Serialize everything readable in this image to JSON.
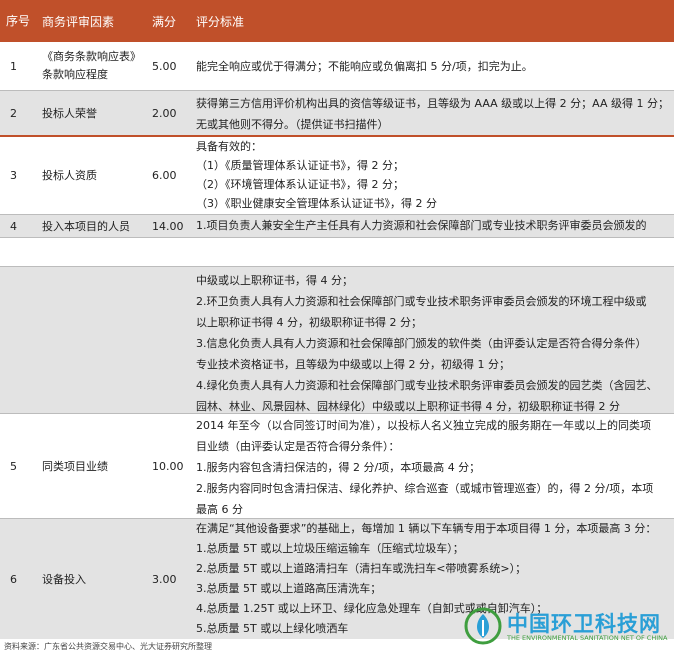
{
  "header": {
    "col_no": "序号",
    "col_factor": "商务评审因素",
    "col_score": "满分",
    "col_criteria": "评分标准"
  },
  "rows": [
    {
      "no": "1",
      "factor": "《商务条款响应表》条款响应程度",
      "score": "5.00",
      "criteria": [
        "能完全响应或优于得满分；不能响应或负偏离扣 5 分/项，扣完为止。"
      ]
    },
    {
      "no": "2",
      "factor": "投标人荣誉",
      "score": "2.00",
      "criteria": [
        "获得第三方信用评价机构出具的资信等级证书，且等级为 AAA 级或以上得 2 分；AA 级得 1 分；",
        "无或其他则不得分。（提供证书扫描件）"
      ]
    },
    {
      "no": "3",
      "factor": "投标人资质",
      "score": "6.00",
      "criteria": [
        "具备有效的：",
        "（1）《质量管理体系认证证书》，得 2 分；",
        "（2）《环境管理体系认证证书》，得 2 分；",
        "（3）《职业健康安全管理体系认证证书》，得 2 分"
      ]
    },
    {
      "no": "4",
      "factor": "投入本项目的人员",
      "score": "14.00",
      "criteria": [
        "1.项目负责人兼安全生产主任具有人力资源和社会保障部门或专业技术职务评审委员会颁发的"
      ]
    },
    {
      "no": "",
      "factor": "",
      "score": "",
      "criteria": [
        "中级或以上职称证书，得 4 分；",
        "2.环卫负责人具有人力资源和社会保障部门或专业技术职务评审委员会颁发的环境工程中级或",
        "以上职称证书得 4 分，初级职称证书得 2 分；",
        "3.信息化负责人具有人力资源和社会保障部门颁发的软件类（由评委认定是否符合得分条件）",
        "专业技术资格证书，且等级为中级或以上得 2 分，初级得 1 分；",
        "4.绿化负责人具有人力资源和社会保障部门或专业技术职务评审委员会颁发的园艺类（含园艺、",
        "园林、林业、风景园林、园林绿化）中级或以上职称证书得 4 分，初级职称证书得 2 分"
      ]
    },
    {
      "no": "5",
      "factor": "同类项目业绩",
      "score": "10.00",
      "criteria": [
        "2014 年至今（以合同签订时间为准），以投标人名义独立完成的服务期在一年或以上的同类项",
        "目业绩（由评委认定是否符合得分条件）：",
        "1.服务内容包含清扫保洁的，得 2 分/项，本项最高 4 分；",
        "2.服务内容同时包含清扫保洁、绿化养护、综合巡查（或城市管理巡查）的，得 2 分/项，本项",
        "最高 6 分"
      ]
    },
    {
      "no": "6",
      "factor": "设备投入",
      "score": "3.00",
      "criteria": [
        "在满足“其他设备要求”的基础上，每增加 1 辆以下车辆专用于本项目得 1 分，本项最高 3 分：",
        "1.总质量 5T 或以上垃圾压缩运输车（压缩式垃圾车）；",
        "2.总质量 5T 或以上道路清扫车（清扫车或洗扫车<带喷雾系统>）；",
        "3.总质量 5T 或以上道路高压清洗车；",
        "4.总质量 1.25T 或以上环卫、绿化应急处理车（自卸式或或自卸汽车）；",
        "5.总质量 5T 或以上绿化喷洒车"
      ]
    }
  ],
  "source": "资料来源：广东省公共资源交易中心、光大证券研究所整理",
  "watermark": {
    "cn": "中国环卫科技网",
    "en": "THE ENVIRONMENTAL SANITATION NET OF CHINA",
    "icon": "environment-logo-icon"
  },
  "colors": {
    "header": "#c0502a",
    "gray_row": "#e3e3e3",
    "logo_blue": "#2a9fd6",
    "logo_green": "#3f9e3f"
  }
}
